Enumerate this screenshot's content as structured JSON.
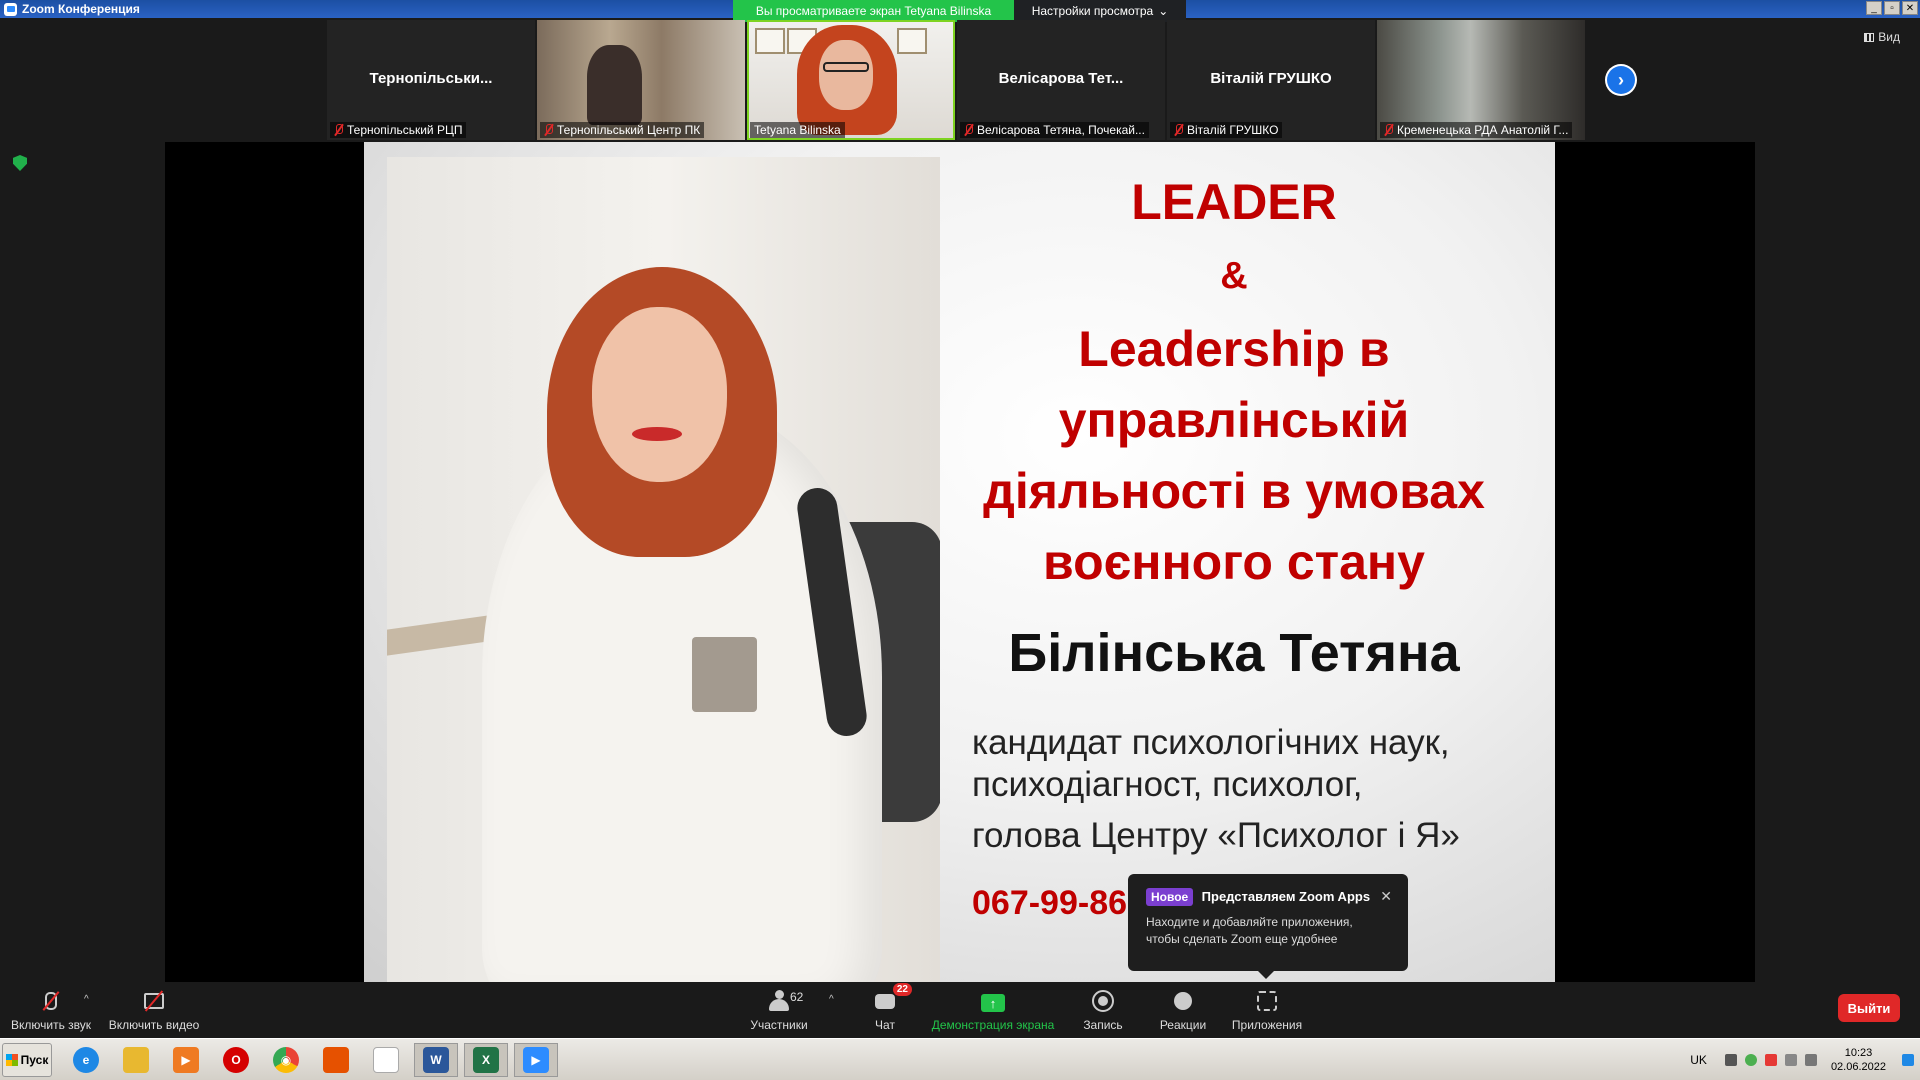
{
  "titlebar": {
    "title": "Zoom Конференция"
  },
  "share_banner": "Вы просматриваете экран Tetyana Bilinska",
  "view_settings": {
    "label": "Настройки просмотра",
    "caret": "⌄"
  },
  "window_buttons": [
    "_",
    "▫",
    "✕"
  ],
  "view_button": "Вид",
  "thumbnails": [
    {
      "name": "Тернопільськи...",
      "label": "Тернопільський РЦП"
    },
    {
      "name": "",
      "label": "Тернопільський Центр ПК"
    },
    {
      "name": "",
      "label": "Tetyana Bilinska"
    },
    {
      "name": "Велісарова Тет...",
      "label": "Велісарова Тетяна, Почекай..."
    },
    {
      "name": "Віталій ГРУШКО",
      "label": "Віталій ГРУШКО"
    },
    {
      "name": "",
      "label": "Кременецька РДА Анатолій Г..."
    }
  ],
  "next_arrow": "›",
  "slide": {
    "title": "LEADER",
    "amp": "&",
    "heading_lines": [
      "Leadership в",
      "управлінській",
      "діяльності в умовах",
      "воєнного стану"
    ],
    "name": "Білінська Тетяна",
    "desc_lines": [
      "кандидат психологічних наук,",
      "психодіагност, психолог,",
      "голова Центру «Психолог і Я»"
    ],
    "phone": "067-99-86"
  },
  "popup": {
    "tag": "Новое",
    "title": "Представляем Zoom Apps",
    "close": "✕",
    "body_line1": "Находите и добавляйте приложения,",
    "body_line2": "чтобы сделать Zoom еще удобнее"
  },
  "toolbar": {
    "mic_label": "Включить звук",
    "video_label": "Включить видео",
    "participants_label": "Участники",
    "participants_count": "62",
    "chat_label": "Чат",
    "chat_badge": "22",
    "share_label": "Демонстрация экрана",
    "share_arrow": "↑",
    "record_label": "Запись",
    "reactions_label": "Реакции",
    "apps_label": "Приложения",
    "caret": "^",
    "leave_label": "Выйти"
  },
  "taskbar": {
    "start_label": "Пуск",
    "apps": [
      {
        "icon": "ie-icon",
        "color": "#1e88e5",
        "glyph": "e"
      },
      {
        "icon": "folder-icon",
        "color": "#e8b830",
        "glyph": ""
      },
      {
        "icon": "media-player-icon",
        "color": "#ef7a22",
        "glyph": "▶"
      },
      {
        "icon": "opera-icon",
        "color": "#d50000",
        "glyph": "O"
      },
      {
        "icon": "chrome-icon",
        "color": "#34a853",
        "glyph": "◉"
      },
      {
        "icon": "tool-icon",
        "color": "#e65100",
        "glyph": ""
      },
      {
        "icon": "document-icon",
        "color": "#ffffff",
        "glyph": ""
      },
      {
        "icon": "word-icon",
        "color": "#2b579a",
        "glyph": "W"
      },
      {
        "icon": "excel-icon",
        "color": "#217346",
        "glyph": "X"
      },
      {
        "icon": "zoom-icon",
        "color": "#2d8cff",
        "glyph": "▶"
      }
    ],
    "lang": "UK",
    "time": "10:23",
    "date": "02.06.2022"
  }
}
